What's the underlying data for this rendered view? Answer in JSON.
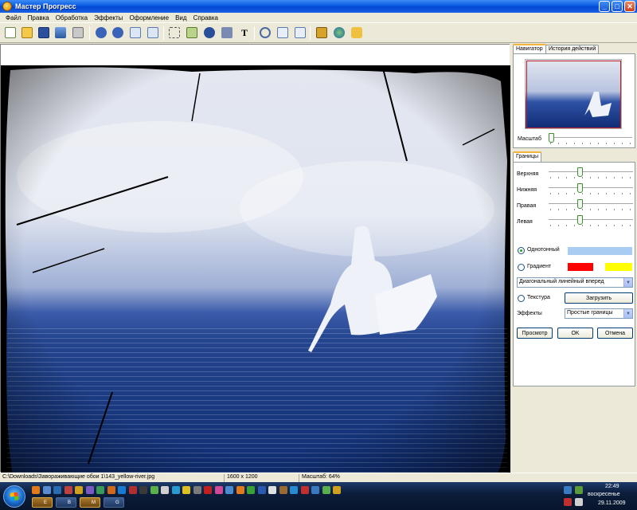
{
  "window": {
    "title": "Мастер Прогресс",
    "minimize_glyph": "_",
    "maximize_glyph": "□",
    "close_glyph": "✕"
  },
  "menu": [
    "Файл",
    "Правка",
    "Обработка",
    "Эффекты",
    "Оформление",
    "Вид",
    "Справка"
  ],
  "toolbar": {
    "icons": [
      "new-icon",
      "open-icon",
      "save-icon",
      "image-icon",
      "print-icon",
      "undo-icon",
      "redo-icon",
      "copy-icon",
      "paste-icon",
      "crop-icon",
      "resize-icon",
      "eye-icon",
      "brush-icon",
      "text-tool-icon",
      "zoom-icon",
      "page-icon",
      "edit-icon",
      "book-icon",
      "globe-icon",
      "help-icon"
    ],
    "text_tool_glyph": "T"
  },
  "navigator": {
    "tabs": [
      "Навигатор",
      "История действий"
    ],
    "zoom_label": "Масштаб",
    "zoom_level": 0.0
  },
  "borders": {
    "tab": "Границы",
    "sliders": [
      {
        "label": "Верхняя",
        "value": 0.36
      },
      {
        "label": "Нижняя",
        "value": 0.36
      },
      {
        "label": "Правая",
        "value": 0.36
      },
      {
        "label": "Левая",
        "value": 0.36
      }
    ],
    "solid_label": "Однотонный",
    "solid_color": "#a9cdf2",
    "gradient_label": "Градиент",
    "gradient_color_1": "#ff0000",
    "gradient_color_2": "#ffff00",
    "gradient_type": "Диагональный линейный вперед",
    "texture_label": "Текстура",
    "load_button": "Загрузить",
    "effects_label": "Эффекты",
    "effects_value": "Простые границы",
    "preview_button": "Просмотр",
    "ok_button": "OK",
    "cancel_button": "Отмена"
  },
  "status": {
    "path": "C:\\Downloads\\Завораживающие обои 1\\143_yellow-river.jpg",
    "size": "1600 x 1200",
    "zoom": "Масштаб: 64%"
  },
  "taskbar": {
    "time": "22:49",
    "day": "воскресенье",
    "date": "29.11.2009",
    "task_labels": [
      "E",
      "B",
      "M",
      "G"
    ]
  },
  "colors": {
    "accent_blue": "#1c3f9a",
    "sky_light": "#e6ebf5",
    "water_dark": "#0b2766"
  }
}
